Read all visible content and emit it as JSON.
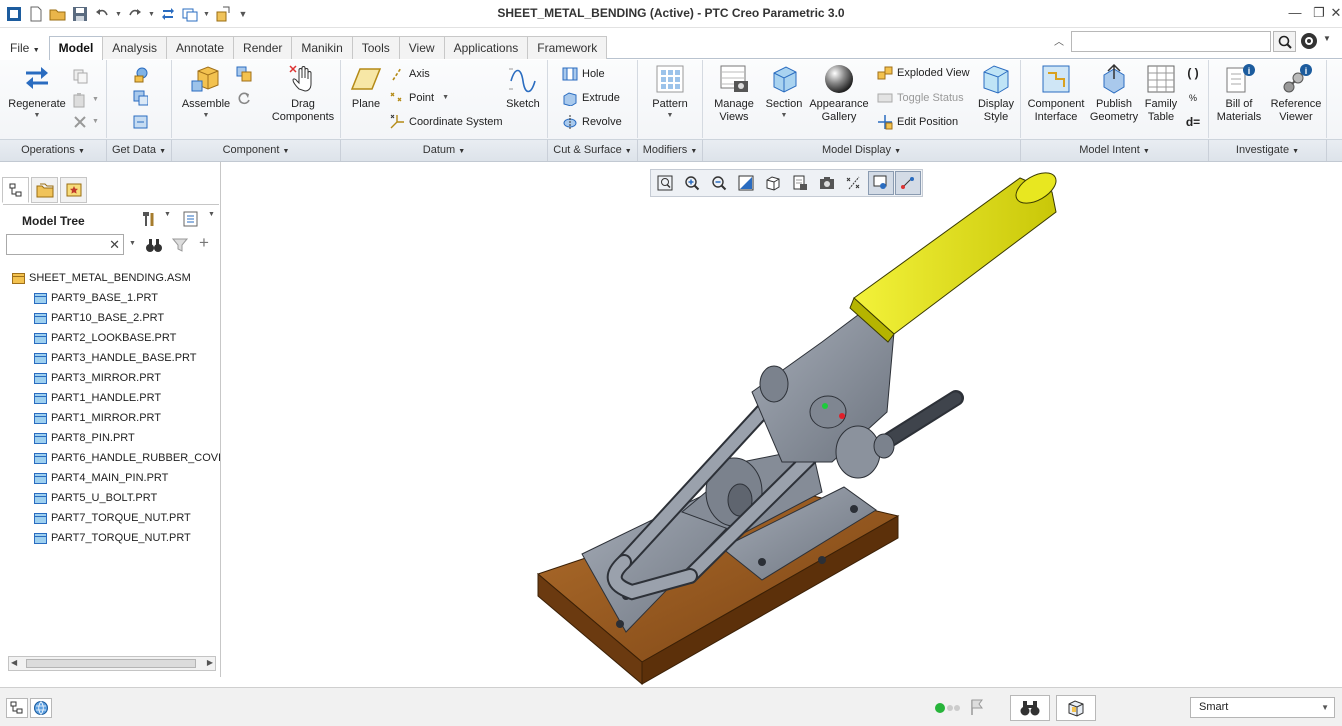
{
  "window": {
    "title": "SHEET_METAL_BENDING (Active) - PTC Creo Parametric 3.0"
  },
  "menu_tabs": [
    "File",
    "Model",
    "Analysis",
    "Annotate",
    "Render",
    "Manikin",
    "Tools",
    "View",
    "Applications",
    "Framework"
  ],
  "active_tab": "Model",
  "ribbon": {
    "operations": {
      "regenerate": "Regenerate",
      "footer": "Operations"
    },
    "get_data": {
      "footer": "Get Data"
    },
    "component": {
      "assemble": "Assemble",
      "drag": "Drag\nComponents",
      "footer": "Component"
    },
    "datum": {
      "plane": "Plane",
      "axis": "Axis",
      "point": "Point",
      "csys": "Coordinate System",
      "sketch": "Sketch",
      "footer": "Datum"
    },
    "cut_surface": {
      "hole": "Hole",
      "extrude": "Extrude",
      "revolve": "Revolve",
      "footer": "Cut & Surface"
    },
    "modifiers": {
      "pattern": "Pattern",
      "footer": "Modifiers"
    },
    "model_display": {
      "manage_views": "Manage\nViews",
      "section": "Section",
      "appearance": "Appearance\nGallery",
      "exploded": "Exploded View",
      "toggle_status": "Toggle Status",
      "edit_position": "Edit Position",
      "display_style": "Display\nStyle",
      "footer": "Model Display"
    },
    "model_intent": {
      "component_interface": "Component\nInterface",
      "publish_geometry": "Publish\nGeometry",
      "family_table": "Family\nTable",
      "footer": "Model Intent"
    },
    "investigate": {
      "bom": "Bill of\nMaterials",
      "reference_viewer": "Reference\nViewer",
      "footer": "Investigate"
    }
  },
  "model_tree": {
    "title": "Model Tree",
    "root": "SHEET_METAL_BENDING.ASM",
    "items": [
      "PART9_BASE_1.PRT",
      "PART10_BASE_2.PRT",
      "PART2_LOOKBASE.PRT",
      "PART3_HANDLE_BASE.PRT",
      "PART3_MIRROR.PRT",
      "PART1_HANDLE.PRT",
      "PART1_MIRROR.PRT",
      "PART8_PIN.PRT",
      "PART6_HANDLE_RUBBER_COVE",
      "PART4_MAIN_PIN.PRT",
      "PART5_U_BOLT.PRT",
      "PART7_TORQUE_NUT.PRT",
      "PART7_TORQUE_NUT.PRT"
    ]
  },
  "status": {
    "selection_filter": "Smart"
  },
  "colors": {
    "handle_yellow": "#e3e21a",
    "metal_gray": "#8f96a3",
    "wood_base": "#9b5b22"
  }
}
